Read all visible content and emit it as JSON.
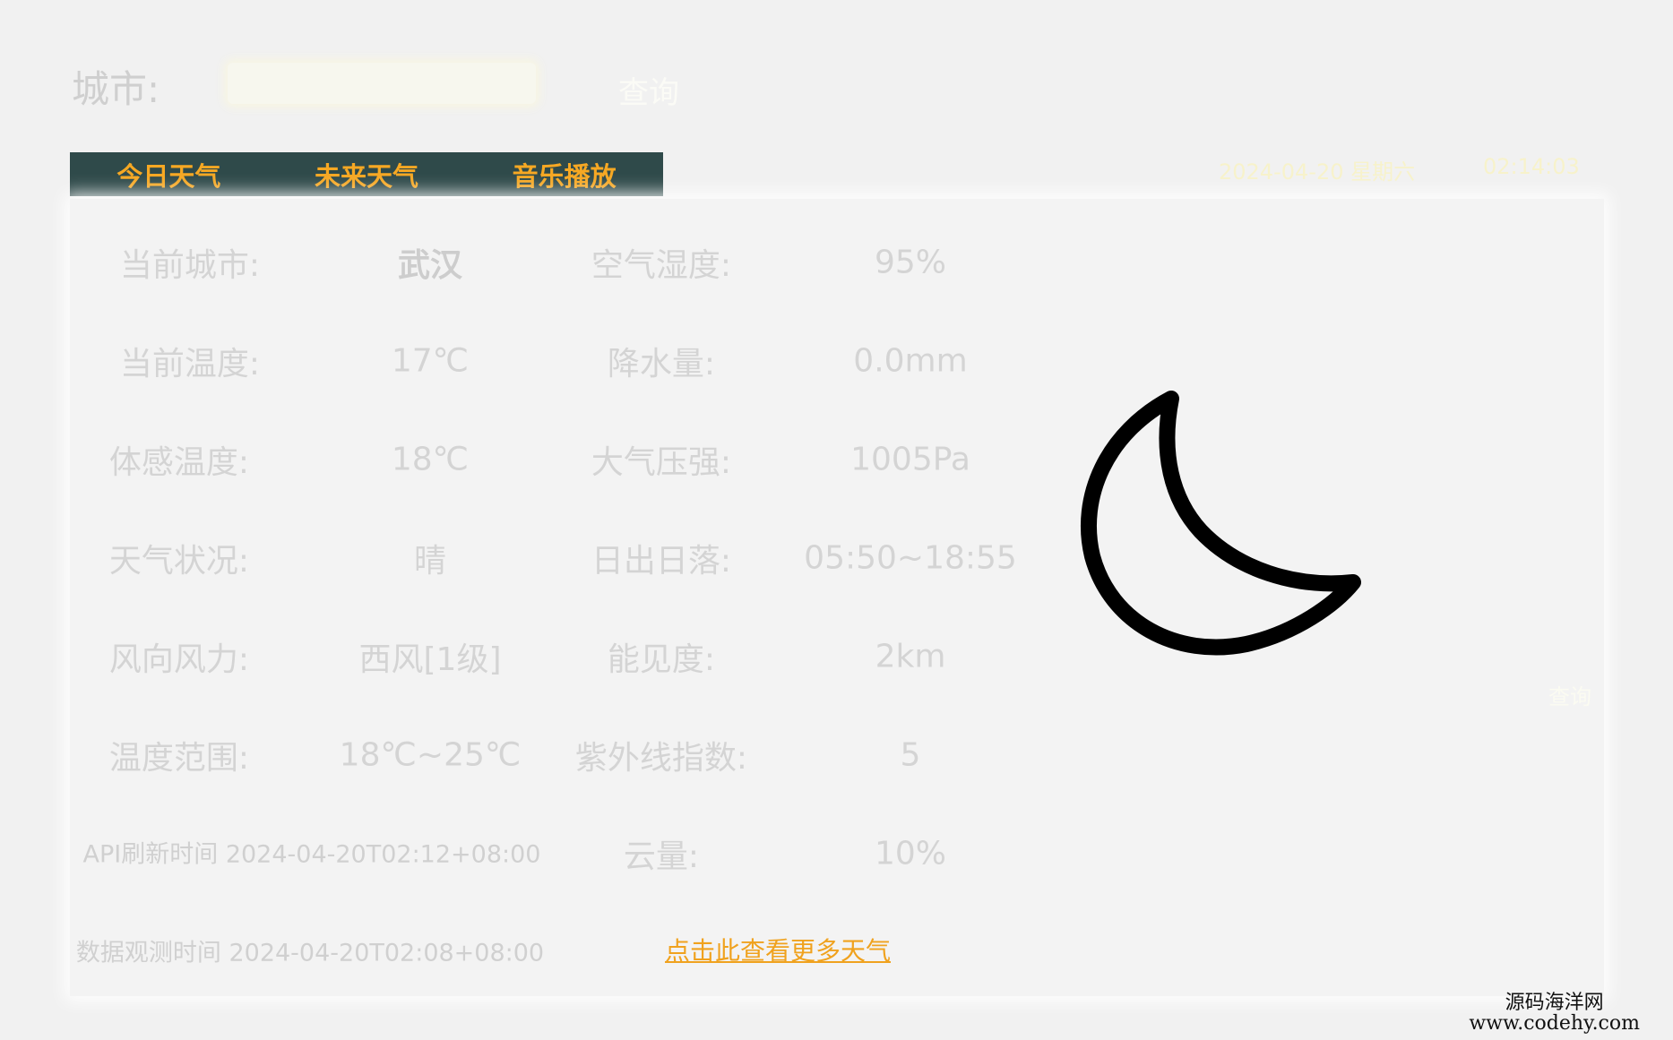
{
  "search": {
    "city_label": "城市:",
    "city_value": "",
    "query_button": "查询"
  },
  "tabs": [
    {
      "label": "今日天气"
    },
    {
      "label": "未来天气"
    },
    {
      "label": "音乐播放"
    }
  ],
  "datetime": {
    "date": "2024-04-20 星期六",
    "time": "02:14:03"
  },
  "weather": {
    "rows": [
      {
        "left_label": "当前城市:",
        "left_value": "武汉",
        "right_label": "空气湿度:",
        "right_value": "95%"
      },
      {
        "left_label": "当前温度:",
        "left_value": "17℃",
        "right_label": "降水量:",
        "right_value": "0.0mm"
      },
      {
        "left_label": "体感温度:",
        "left_value": "18℃",
        "right_label": "大气压强:",
        "right_value": "1005Pa"
      },
      {
        "left_label": "天气状况:",
        "left_value": "晴",
        "right_label": "日出日落:",
        "right_value": "05:50~18:55"
      },
      {
        "left_label": "风向风力:",
        "left_value": "西风[1级]",
        "right_label": "能见度:",
        "right_value": "2km"
      },
      {
        "left_label": "温度范围:",
        "left_value": "18℃~25℃",
        "right_label": "紫外线指数:",
        "right_value": "5"
      }
    ],
    "api_refresh": "API刷新时间  2024-04-20T02:12+08:00",
    "cloud_label": "云量:",
    "cloud_value": "10%",
    "observe_time": "数据观测时间  2024-04-20T02:08+08:00",
    "more_link": "点击此查看更多天气",
    "icon": "moon-icon"
  },
  "side_button": "查询",
  "watermark": {
    "line1": "源码海洋网",
    "line2": "www.codehy.com"
  }
}
